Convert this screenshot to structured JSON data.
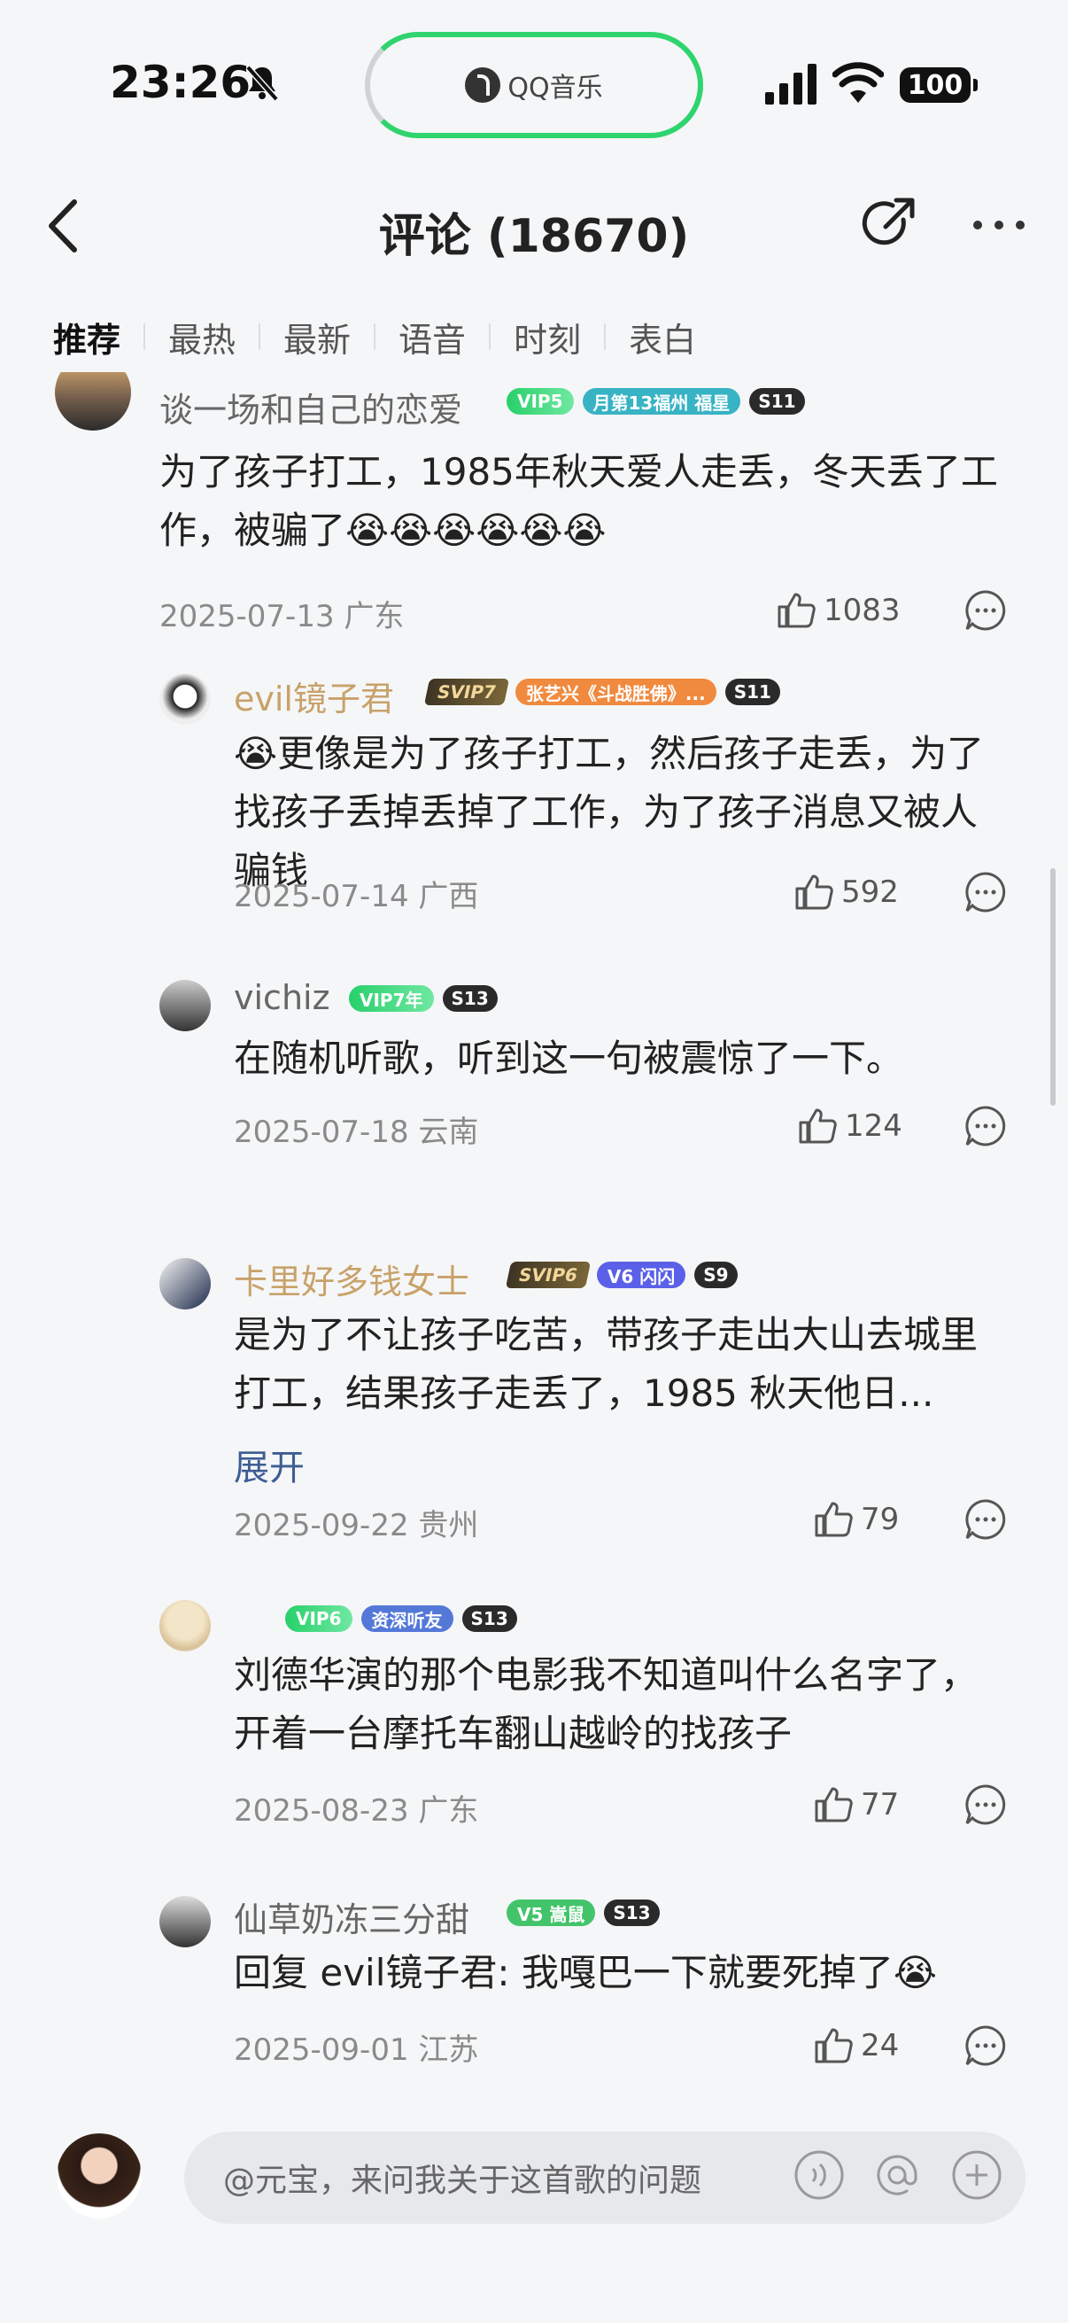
{
  "status_bar": {
    "time": "23:26",
    "battery": "100",
    "app_pill_label": "QQ音乐"
  },
  "header": {
    "title": "评论 (18670)"
  },
  "tabs": [
    {
      "label": "推荐",
      "active": true
    },
    {
      "label": "最热"
    },
    {
      "label": "最新"
    },
    {
      "label": "语音"
    },
    {
      "label": "时刻"
    },
    {
      "label": "表白"
    }
  ],
  "comments": [
    {
      "username": "谈一场和自己的恋爱",
      "badges": [
        "VIP5",
        "月第13福州 福星",
        "S11"
      ],
      "text": "为了孩子打工，1985年秋天爱人走丢，冬天丢了工作，被骗了",
      "emoji": "😭😭😭😭😭😭",
      "date": "2025-07-13 广东",
      "likes": "1083"
    },
    {
      "username": "evil镜子君",
      "badges": [
        "SVIP7",
        "张艺兴《斗战胜佛》...",
        "S11"
      ],
      "text": "更像是为了孩子打工，然后孩子走丢，为了找孩子丢掉丢掉了工作，为了孩子消息又被人骗钱",
      "emoji": "😭",
      "date": "2025-07-14 广西",
      "likes": "592"
    },
    {
      "username": "vichiz",
      "badges": [
        "VIP7年",
        "S13"
      ],
      "text": "在随机听歌，听到这一句被震惊了一下。",
      "date": "2025-07-18 云南",
      "likes": "124"
    },
    {
      "username": "卡里好多钱女士",
      "badges": [
        "SVIP6",
        "V6 闪闪",
        "S9"
      ],
      "text": "是为了不让孩子吃苦，带孩子走出大山去城里打工，结果孩子走丢了，1985 秋天他日...",
      "expand": "展开",
      "date": "2025-09-22 贵州",
      "likes": "79"
    },
    {
      "username": "",
      "badges": [
        "VIP6",
        "资深听友",
        "S13"
      ],
      "text": "刘德华演的那个电影我不知道叫什么名字了，开着一台摩托车翻山越岭的找孩子",
      "date": "2025-08-23 广东",
      "likes": "77"
    },
    {
      "username": "仙草奶冻三分甜",
      "badges": [
        "V5 嵩鼠",
        "S13"
      ],
      "text": "回复 evil镜子君: 我嘎巴一下就要死掉了",
      "emoji": "😭",
      "date": "2025-09-01 江苏",
      "likes": "24"
    }
  ],
  "input_bar": {
    "placeholder": "@元宝，来问我关于这首歌的问题"
  },
  "colors": {
    "accent_green": "#2fd46e",
    "gold_name": "#c8a26a",
    "link_blue": "#3d5d93"
  }
}
